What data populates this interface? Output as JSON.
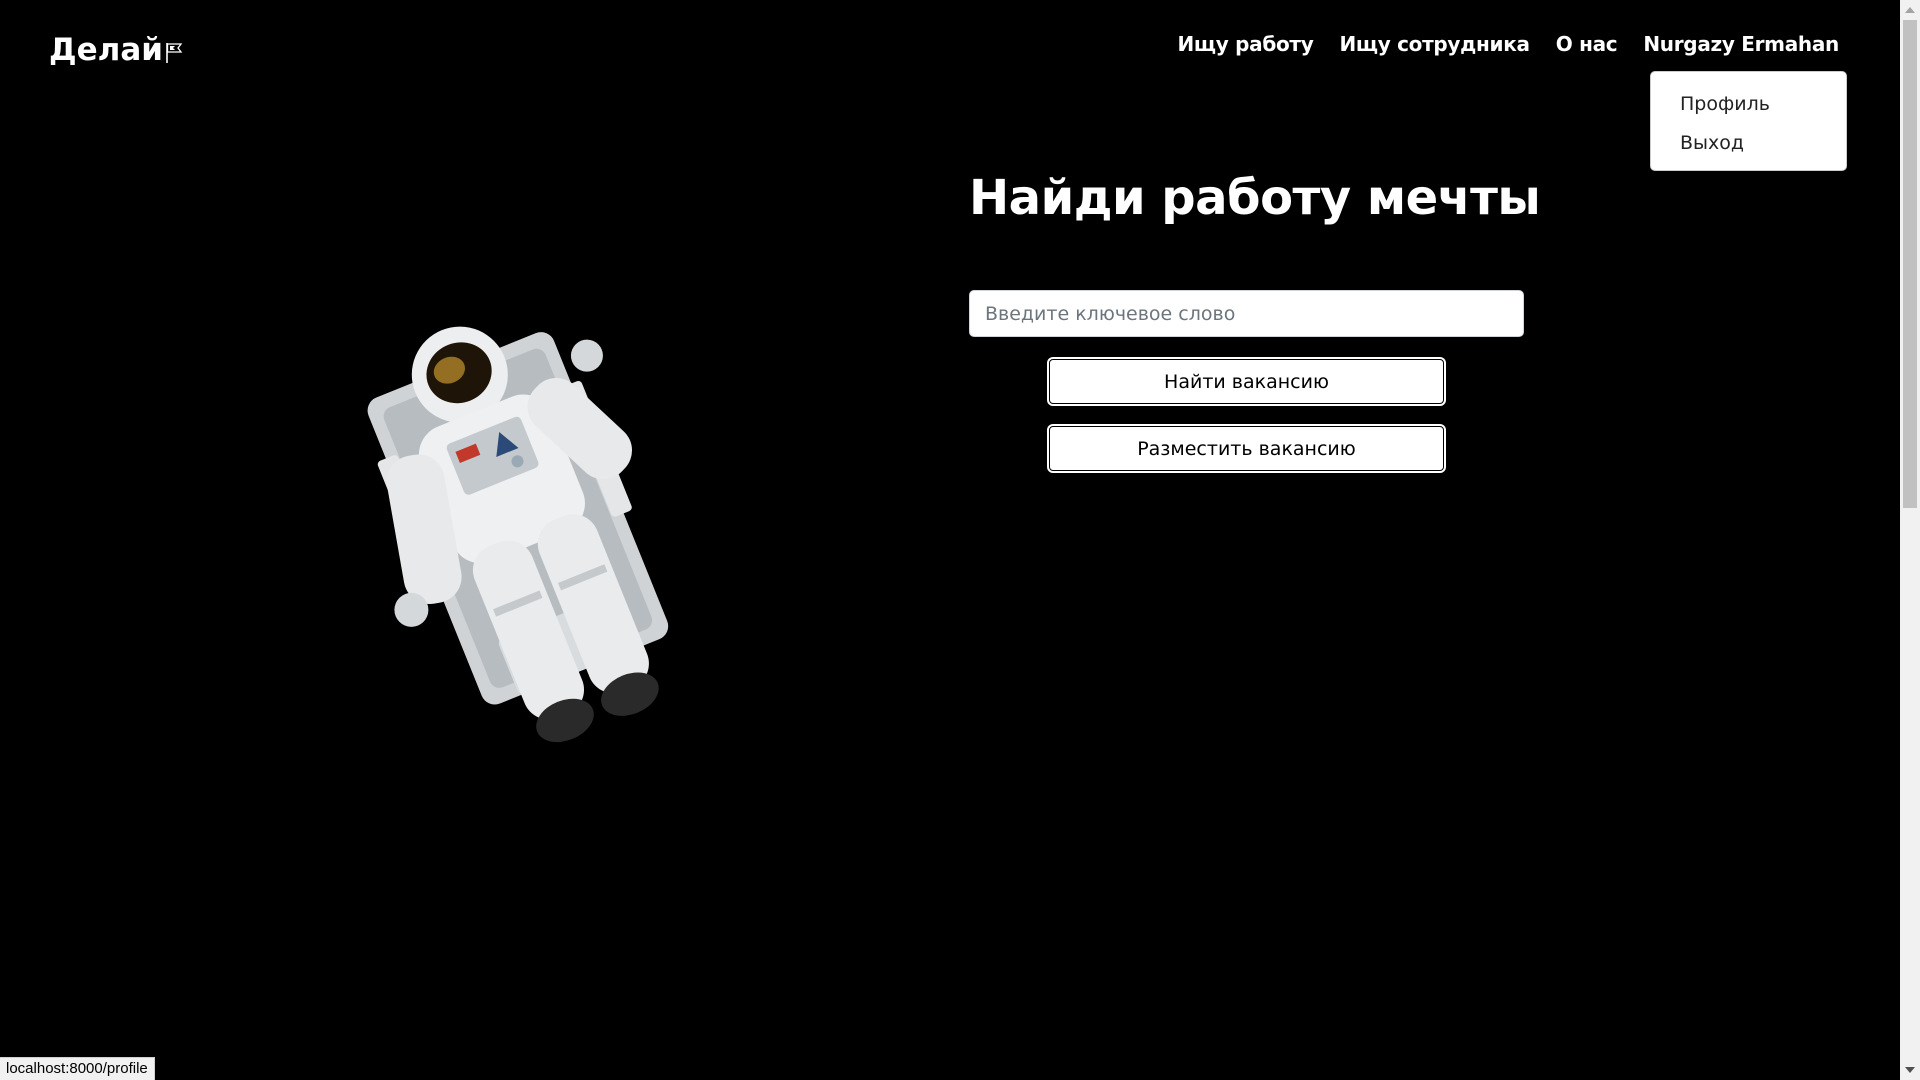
{
  "brand": {
    "name": "Делай",
    "icon": "flag-icon"
  },
  "nav": {
    "items": [
      {
        "label": "Ищу работу"
      },
      {
        "label": "Ищу сотрудника"
      },
      {
        "label": "О нас"
      },
      {
        "label": "Nurgazy Ermahan"
      }
    ]
  },
  "user_menu": {
    "items": [
      {
        "label": "Профиль"
      },
      {
        "label": "Выход"
      }
    ]
  },
  "hero": {
    "title": "Найди работу мечты",
    "search_placeholder": "Введите ключевое слово",
    "search_value": "",
    "find_button": "Найти вакансию",
    "post_button": "Разместить вакансию"
  },
  "illustration": {
    "icon": "astronaut-image"
  },
  "status_bar": {
    "url": "localhost:8000/profile"
  },
  "colors": {
    "background": "#000000",
    "text_light": "#ffffff",
    "button_bg": "#ffffff",
    "dropdown_bg": "#ffffff"
  }
}
